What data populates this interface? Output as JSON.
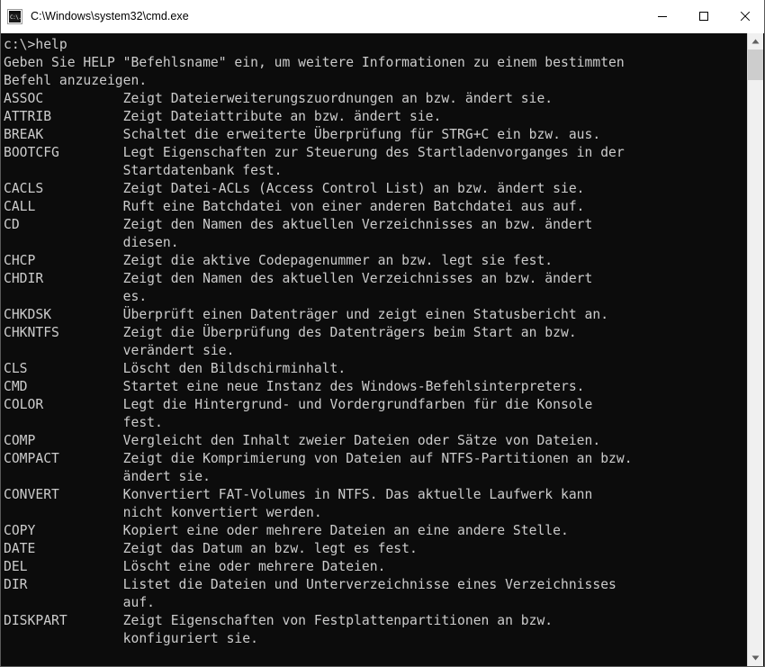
{
  "window": {
    "title": "C:\\Windows\\system32\\cmd.exe",
    "icon": "cmd-console-icon",
    "icon_glyph": "C:\\.",
    "background_color": "#0c0c0c",
    "foreground_color": "#cccccc",
    "titlebar_background": "#ffffff",
    "titlebar_text_color": "#000000"
  },
  "controls": {
    "minimize": {
      "name": "minimize-button",
      "glyph": "—"
    },
    "maximize": {
      "name": "maximize-button",
      "glyph": "▢"
    },
    "close": {
      "name": "close-button",
      "glyph": "✕"
    }
  },
  "scrollbar": {
    "up_arrow": "▲",
    "down_arrow": "▼",
    "thumb_position_percent": 0,
    "track_color": "#f0f0f0",
    "thumb_color": "#cdcdcd"
  },
  "console": {
    "prompt": "c:\\>",
    "command": "help",
    "prompt_line": "c:\\>help",
    "intro_lines": [
      "Geben Sie HELP \"Befehlsname\" ein, um weitere Informationen zu einem bestimmten",
      "Befehl anzuzeigen."
    ],
    "commands": [
      {
        "name": "ASSOC",
        "description": [
          "Zeigt Dateierweiterungszuordnungen an bzw. ändert sie."
        ]
      },
      {
        "name": "ATTRIB",
        "description": [
          "Zeigt Dateiattribute an bzw. ändert sie."
        ]
      },
      {
        "name": "BREAK",
        "description": [
          "Schaltet die erweiterte Überprüfung für STRG+C ein bzw. aus."
        ]
      },
      {
        "name": "BOOTCFG",
        "description": [
          "Legt Eigenschaften zur Steuerung des Startladenvorganges in der",
          "Startdatenbank fest."
        ]
      },
      {
        "name": "CACLS",
        "description": [
          "Zeigt Datei-ACLs (Access Control List) an bzw. ändert sie."
        ]
      },
      {
        "name": "CALL",
        "description": [
          "Ruft eine Batchdatei von einer anderen Batchdatei aus auf."
        ]
      },
      {
        "name": "CD",
        "description": [
          "Zeigt den Namen des aktuellen Verzeichnisses an bzw. ändert",
          "diesen."
        ]
      },
      {
        "name": "CHCP",
        "description": [
          "Zeigt die aktive Codepagenummer an bzw. legt sie fest."
        ]
      },
      {
        "name": "CHDIR",
        "description": [
          "Zeigt den Namen des aktuellen Verzeichnisses an bzw. ändert",
          "es."
        ]
      },
      {
        "name": "CHKDSK",
        "description": [
          "Überprüft einen Datenträger und zeigt einen Statusbericht an."
        ]
      },
      {
        "name": "CHKNTFS",
        "description": [
          "Zeigt die Überprüfung des Datenträgers beim Start an bzw.",
          "verändert sie."
        ]
      },
      {
        "name": "CLS",
        "description": [
          "Löscht den Bildschirminhalt."
        ]
      },
      {
        "name": "CMD",
        "description": [
          "Startet eine neue Instanz des Windows-Befehlsinterpreters."
        ]
      },
      {
        "name": "COLOR",
        "description": [
          "Legt die Hintergrund- und Vordergrundfarben für die Konsole",
          "fest."
        ]
      },
      {
        "name": "COMP",
        "description": [
          "Vergleicht den Inhalt zweier Dateien oder Sätze von Dateien."
        ]
      },
      {
        "name": "COMPACT",
        "description": [
          "Zeigt die Komprimierung von Dateien auf NTFS-Partitionen an bzw.",
          "ändert sie."
        ]
      },
      {
        "name": "CONVERT",
        "description": [
          "Konvertiert FAT-Volumes in NTFS. Das aktuelle Laufwerk kann",
          "nicht konvertiert werden."
        ]
      },
      {
        "name": "COPY",
        "description": [
          "Kopiert eine oder mehrere Dateien an eine andere Stelle."
        ]
      },
      {
        "name": "DATE",
        "description": [
          "Zeigt das Datum an bzw. legt es fest."
        ]
      },
      {
        "name": "DEL",
        "description": [
          "Löscht eine oder mehrere Dateien."
        ]
      },
      {
        "name": "DIR",
        "description": [
          "Listet die Dateien und Unterverzeichnisse eines Verzeichnisses",
          "auf."
        ]
      },
      {
        "name": "DISKPART",
        "description": [
          "Zeigt Eigenschaften von Festplattenpartitionen an bzw.",
          "konfiguriert sie."
        ]
      }
    ]
  }
}
